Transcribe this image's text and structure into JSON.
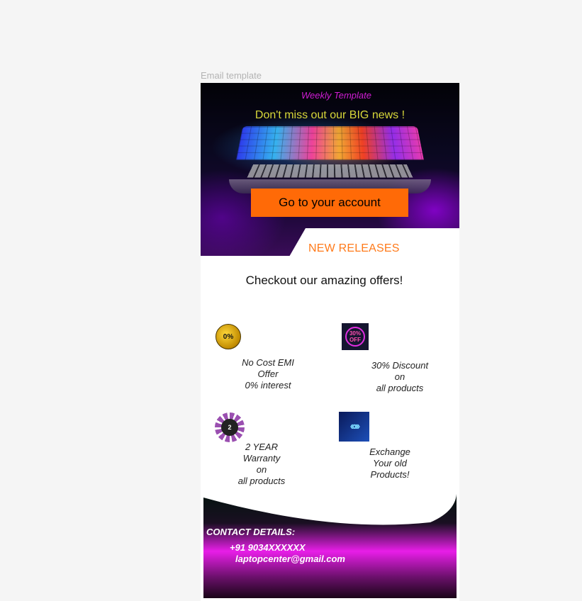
{
  "frame_label": "Email template",
  "hero": {
    "weekly": "Weekly Template",
    "tagline": "Don't miss out our BIG news !",
    "cta_label": "Go to your account",
    "image_icon": "laptop-image"
  },
  "section": {
    "new_releases": "NEW RELEASES",
    "heading": "Checkout our amazing offers!"
  },
  "offers": [
    {
      "icon": "zero-percent-emi-badge-icon",
      "badge": "0%",
      "text": "No Cost EMI\nOffer\n0% interest"
    },
    {
      "icon": "thirty-percent-off-icon",
      "badge": "30%\nOFF",
      "text": "30% Discount\non\nall products"
    },
    {
      "icon": "warranty-badge-icon",
      "badge": "2",
      "text": "2 YEAR\nWarranty\non\nall products"
    },
    {
      "icon": "exchange-arrows-icon",
      "badge": "",
      "text": "Exchange\nYour old\nProducts!"
    }
  ],
  "footer": {
    "title": "CONTACT DETAILS:",
    "phone": "+91 9034XXXXXX",
    "email": "laptopcenter@gmail.com"
  },
  "colors": {
    "accent_orange": "#ff6a07",
    "weekly_magenta": "#d11dd4",
    "tagline_yellow": "#d8d83a",
    "footer_magenta": "#e81ee8"
  }
}
